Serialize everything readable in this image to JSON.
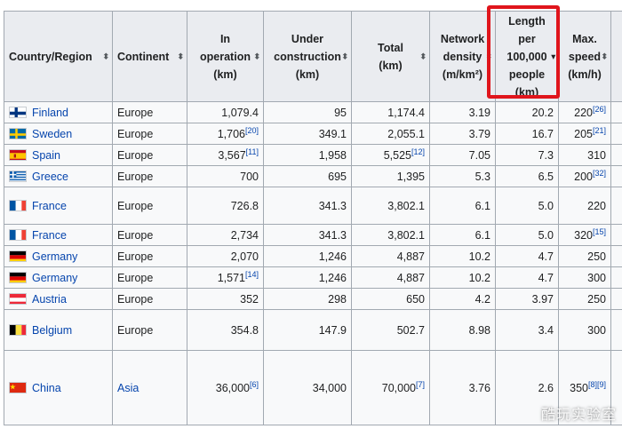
{
  "table": {
    "headers": [
      {
        "lines": [
          "Country/Region"
        ]
      },
      {
        "lines": [
          "Continent"
        ]
      },
      {
        "lines": [
          "In",
          "operation",
          "(km)"
        ]
      },
      {
        "lines": [
          "Under",
          "construction",
          "(km)"
        ]
      },
      {
        "lines": [
          "Total",
          "(km)"
        ]
      },
      {
        "lines": [
          "Network",
          "density",
          "(m/km²)"
        ]
      },
      {
        "lines": [
          "Length",
          "per",
          "100,000",
          "people",
          "(km)"
        ]
      },
      {
        "lines": [
          "Max.",
          "speed",
          "(km/h)"
        ]
      }
    ],
    "rows": [
      {
        "flag": "finland",
        "country": "Finland",
        "continent": "Europe",
        "in_operation": "1,079.4",
        "in_operation_ref": "",
        "under_construction": "95",
        "total": "1,174.4",
        "total_ref": "",
        "density": "3.19",
        "per_100k": "20.2",
        "max_speed": "220",
        "max_speed_ref": "[26]"
      },
      {
        "flag": "sweden",
        "country": "Sweden",
        "continent": "Europe",
        "in_operation": "1,706",
        "in_operation_ref": "[20]",
        "under_construction": "349.1",
        "total": "2,055.1",
        "total_ref": "",
        "density": "3.79",
        "per_100k": "16.7",
        "max_speed": "205",
        "max_speed_ref": "[21]"
      },
      {
        "flag": "spain",
        "country": "Spain",
        "continent": "Europe",
        "in_operation": "3,567",
        "in_operation_ref": "[11]",
        "under_construction": "1,958",
        "total": "5,525",
        "total_ref": "[12]",
        "density": "7.05",
        "per_100k": "7.3",
        "max_speed": "310",
        "max_speed_ref": ""
      },
      {
        "flag": "greece",
        "country": "Greece",
        "continent": "Europe",
        "in_operation": "700",
        "in_operation_ref": "",
        "under_construction": "695",
        "total": "1,395",
        "total_ref": "",
        "density": "5.3",
        "per_100k": "6.5",
        "max_speed": "200",
        "max_speed_ref": "[32]"
      },
      {
        "flag": "france",
        "country": "France",
        "continent": "Europe",
        "in_operation": "726.8",
        "in_operation_ref": "",
        "under_construction": "341.3",
        "total": "3,802.1",
        "total_ref": "",
        "density": "6.1",
        "per_100k": "5.0",
        "max_speed": "220",
        "max_speed_ref": ""
      },
      {
        "flag": "france",
        "country": "France",
        "continent": "Europe",
        "in_operation": "2,734",
        "in_operation_ref": "",
        "under_construction": "341.3",
        "total": "3,802.1",
        "total_ref": "",
        "density": "6.1",
        "per_100k": "5.0",
        "max_speed": "320",
        "max_speed_ref": "[15]"
      },
      {
        "flag": "germany",
        "country": "Germany",
        "continent": "Europe",
        "in_operation": "2,070",
        "in_operation_ref": "",
        "under_construction": "1,246",
        "total": "4,887",
        "total_ref": "",
        "density": "10.2",
        "per_100k": "4.7",
        "max_speed": "250",
        "max_speed_ref": ""
      },
      {
        "flag": "germany",
        "country": "Germany",
        "continent": "Europe",
        "in_operation": "1,571",
        "in_operation_ref": "[14]",
        "under_construction": "1,246",
        "total": "4,887",
        "total_ref": "",
        "density": "10.2",
        "per_100k": "4.7",
        "max_speed": "300",
        "max_speed_ref": ""
      },
      {
        "flag": "austria",
        "country": "Austria",
        "continent": "Europe",
        "in_operation": "352",
        "in_operation_ref": "",
        "under_construction": "298",
        "total": "650",
        "total_ref": "",
        "density": "4.2",
        "per_100k": "3.97",
        "max_speed": "250",
        "max_speed_ref": ""
      },
      {
        "flag": "belgium",
        "country": "Belgium",
        "continent": "Europe",
        "in_operation": "354.8",
        "in_operation_ref": "",
        "under_construction": "147.9",
        "total": "502.7",
        "total_ref": "",
        "density": "8.98",
        "per_100k": "3.4",
        "max_speed": "300",
        "max_speed_ref": ""
      },
      {
        "flag": "china",
        "country": "China",
        "continent": "Asia",
        "in_operation": "36,000",
        "in_operation_ref": "[6]",
        "under_construction": "34,000",
        "total": "70,000",
        "total_ref": "[7]",
        "density": "3.76",
        "per_100k": "2.6",
        "max_speed": "350",
        "max_speed_ref": "[8][9]"
      }
    ]
  },
  "highlight": {
    "column": "Length per 100,000 people (km)",
    "color": "#e0151c"
  },
  "watermark": "酷玩实验室",
  "colors": {
    "header_bg": "#eaecf0",
    "cell_bg": "#f8f9fa",
    "border": "#a2a9b1",
    "link": "#0645ad"
  }
}
